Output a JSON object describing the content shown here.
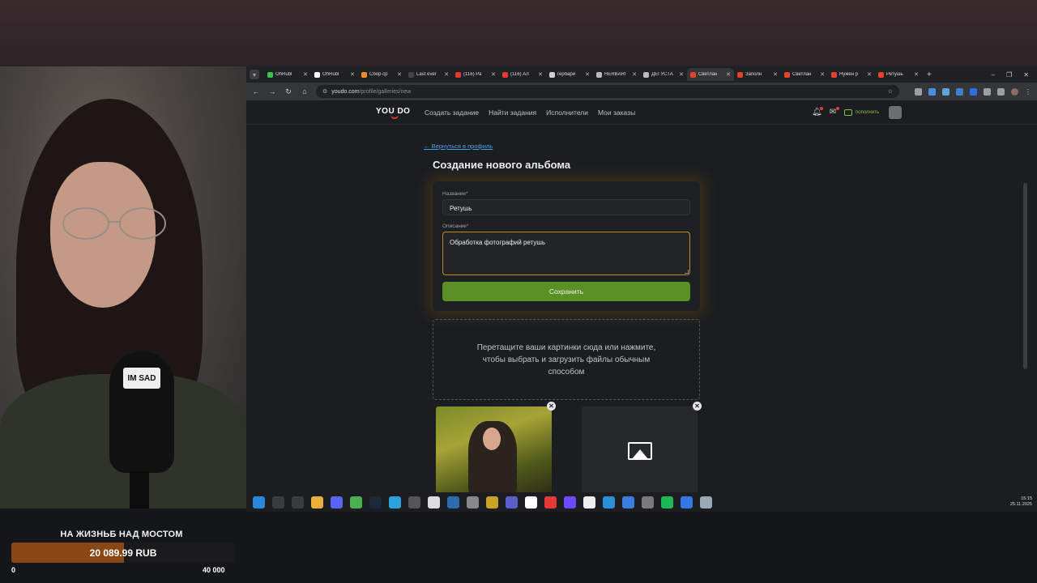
{
  "browser": {
    "tabs": [
      {
        "title": "OhRubl",
        "color": "#3ec24a"
      },
      {
        "title": "OhRubl",
        "color": "#ffffff"
      },
      {
        "title": "Сбор ср",
        "color": "#f08a24"
      },
      {
        "title": "Last ever",
        "color": "#444444"
      },
      {
        "title": "(116) Ра",
        "color": "#e53935"
      },
      {
        "title": "(116) Ал",
        "color": "#e53935"
      },
      {
        "title": "гербари",
        "color": "#cfcfcf"
      },
      {
        "title": "HERBARI",
        "color": "#bbbbbb"
      },
      {
        "title": "ДЕГУСТА",
        "color": "#bbbbbb"
      },
      {
        "title": "Светлан",
        "color": "#e6412d",
        "active": true
      },
      {
        "title": "Заполн",
        "color": "#e6412d"
      },
      {
        "title": "Светлан",
        "color": "#e6412d"
      },
      {
        "title": "Нужен р",
        "color": "#e6412d"
      },
      {
        "title": "Ретушь",
        "color": "#e6412d"
      }
    ],
    "new_tab": "+",
    "url_host": "youdo.com",
    "url_path": "/profile/galleries/new"
  },
  "site": {
    "logo": "YOU DO",
    "nav": [
      "Создать задание",
      "Найти задания",
      "Исполнители",
      "Мои заказы"
    ],
    "wallet_label": "пополнить"
  },
  "page": {
    "back_link": "← Вернуться в профиль",
    "title": "Создание нового альбома",
    "name_label": "Название*",
    "name_value": "Ретушь",
    "description_label": "Описание*",
    "description_value": "Обработка фотографий ретушь",
    "save_button": "Сохранить",
    "dropzone_text": "Перетащите ваши картинки сюда или нажмите, чтобы выбрать и загрузить файлы обычным способом"
  },
  "taskbar": {
    "time": "15:15",
    "date": "25.11.2025",
    "icons": [
      {
        "name": "windows-start-icon",
        "color": "#2b88d8"
      },
      {
        "name": "search-icon",
        "color": "#3a3b3f"
      },
      {
        "name": "task-view-icon",
        "color": "#3a3b3f"
      },
      {
        "name": "file-explorer-icon",
        "color": "#e8b23a"
      },
      {
        "name": "discord-icon",
        "color": "#5865f2"
      },
      {
        "name": "chrome-icon",
        "color": "#4caf50"
      },
      {
        "name": "steam-icon",
        "color": "#1b2838"
      },
      {
        "name": "telegram-icon",
        "color": "#2aa3df"
      },
      {
        "name": "obs-icon",
        "color": "#555555"
      },
      {
        "name": "document-icon",
        "color": "#dddddd"
      },
      {
        "name": "lc-icon",
        "color": "#2b6cb0"
      },
      {
        "name": "cloud-icon",
        "color": "#888888"
      },
      {
        "name": "app-icon",
        "color": "#c9a227"
      },
      {
        "name": "t-icon",
        "color": "#5b5fc7"
      },
      {
        "name": "yandex-browser-icon",
        "color": "#ffffff"
      },
      {
        "name": "yandex-icon",
        "color": "#e53935"
      },
      {
        "name": "proton-icon",
        "color": "#6d4aff"
      },
      {
        "name": "notes-icon",
        "color": "#eeeeee"
      },
      {
        "name": "c-icon",
        "color": "#2c8fd6"
      },
      {
        "name": "stats-icon",
        "color": "#3b7ddd"
      },
      {
        "name": "globe-icon",
        "color": "#7a7a7a"
      },
      {
        "name": "spotify-icon",
        "color": "#1db954"
      },
      {
        "name": "video-icon",
        "color": "#3578e5"
      },
      {
        "name": "calculator-icon",
        "color": "#9aa7b5"
      }
    ]
  },
  "donation_goal": {
    "title": "НА ЖИЗНЬБ НАД МОСТОМ",
    "amount": "20 089.99 RUB",
    "min": "0",
    "max": "40 000",
    "progress": 0.5022,
    "fill_color": "#8a4716"
  }
}
